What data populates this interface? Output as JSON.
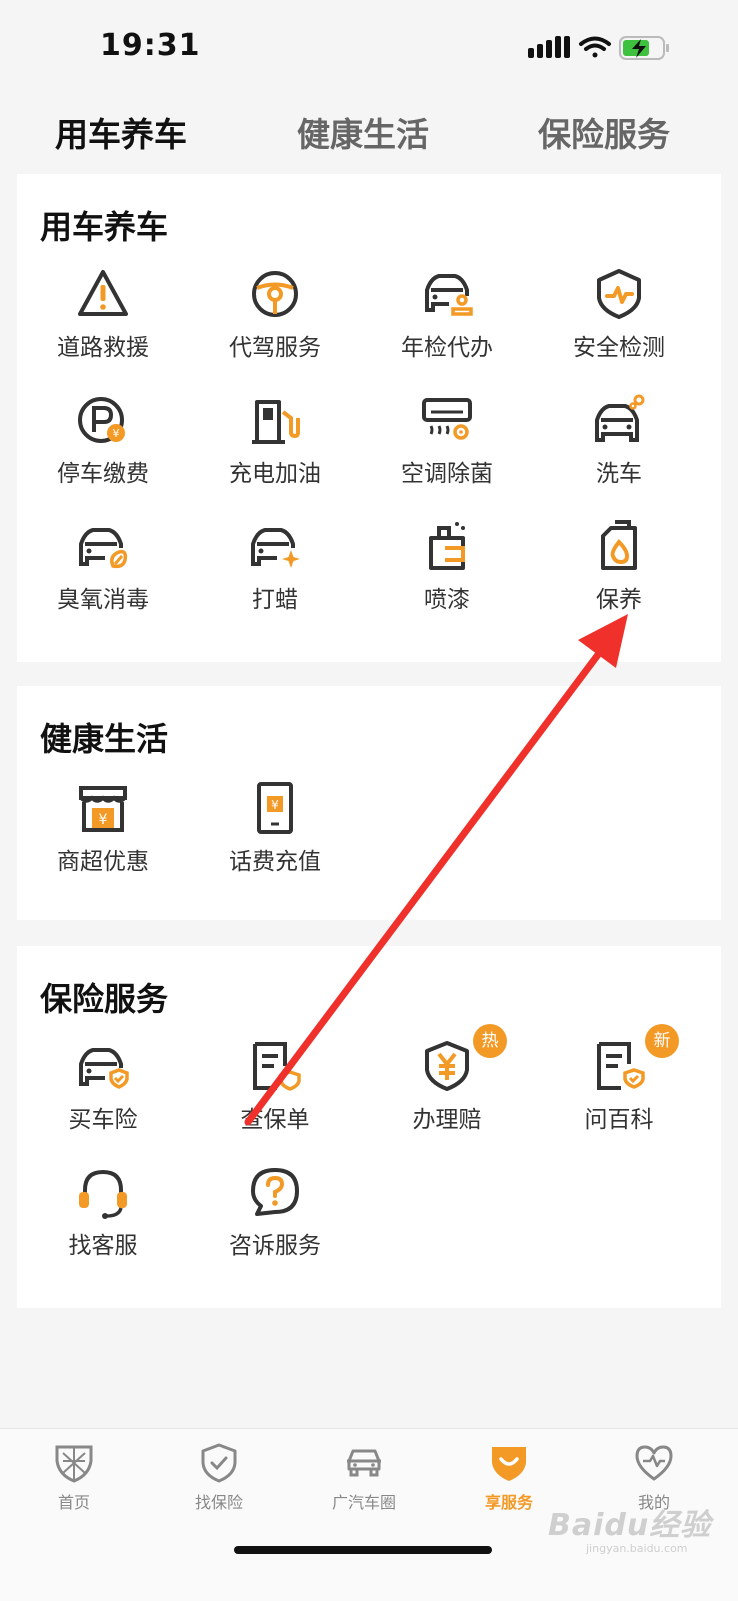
{
  "status_bar": {
    "time": "19:31"
  },
  "top_tabs": [
    {
      "label": "用车养车",
      "active": true
    },
    {
      "label": "健康生活",
      "active": false
    },
    {
      "label": "保险服务",
      "active": false
    }
  ],
  "sections": [
    {
      "title": "用车养车",
      "items": [
        {
          "label": "道路救援",
          "icon": "warning-triangle-icon"
        },
        {
          "label": "代驾服务",
          "icon": "steering-wheel-icon"
        },
        {
          "label": "年检代办",
          "icon": "car-stamp-icon"
        },
        {
          "label": "安全检测",
          "icon": "shield-pulse-icon"
        },
        {
          "label": "停车缴费",
          "icon": "parking-fee-icon"
        },
        {
          "label": "充电加油",
          "icon": "fuel-charge-icon"
        },
        {
          "label": "空调除菌",
          "icon": "air-conditioner-icon"
        },
        {
          "label": "洗车",
          "icon": "car-wash-icon"
        },
        {
          "label": "臭氧消毒",
          "icon": "car-disinfect-icon"
        },
        {
          "label": "打蜡",
          "icon": "car-wax-icon"
        },
        {
          "label": "喷漆",
          "icon": "spray-paint-icon"
        },
        {
          "label": "保养",
          "icon": "oil-can-icon"
        }
      ]
    },
    {
      "title": "健康生活",
      "items": [
        {
          "label": "商超优惠",
          "icon": "shop-icon"
        },
        {
          "label": "话费充值",
          "icon": "phone-recharge-icon"
        }
      ]
    },
    {
      "title": "保险服务",
      "items": [
        {
          "label": "买车险",
          "icon": "car-insurance-icon"
        },
        {
          "label": "查保单",
          "icon": "policy-document-icon"
        },
        {
          "label": "办理赔",
          "icon": "claim-shield-icon",
          "badge": "热"
        },
        {
          "label": "问百科",
          "icon": "encyclopedia-icon",
          "badge": "新"
        },
        {
          "label": "找客服",
          "icon": "headset-icon"
        },
        {
          "label": "咨诉服务",
          "icon": "question-bubble-icon"
        }
      ]
    }
  ],
  "bottom_nav": [
    {
      "label": "首页",
      "icon": "home-crest-icon",
      "active": false
    },
    {
      "label": "找保险",
      "icon": "shield-check-icon",
      "active": false
    },
    {
      "label": "广汽车圈",
      "icon": "car-circle-icon",
      "active": false
    },
    {
      "label": "享服务",
      "icon": "service-smile-icon",
      "active": true
    },
    {
      "label": "我的",
      "icon": "heart-icon",
      "active": false
    }
  ],
  "watermark": {
    "text": "Baidu经验",
    "url": "jingyan.baidu.com"
  },
  "colors": {
    "accent": "#f39a26",
    "icon_stroke": "#333333",
    "arrow": "#f0302a"
  }
}
